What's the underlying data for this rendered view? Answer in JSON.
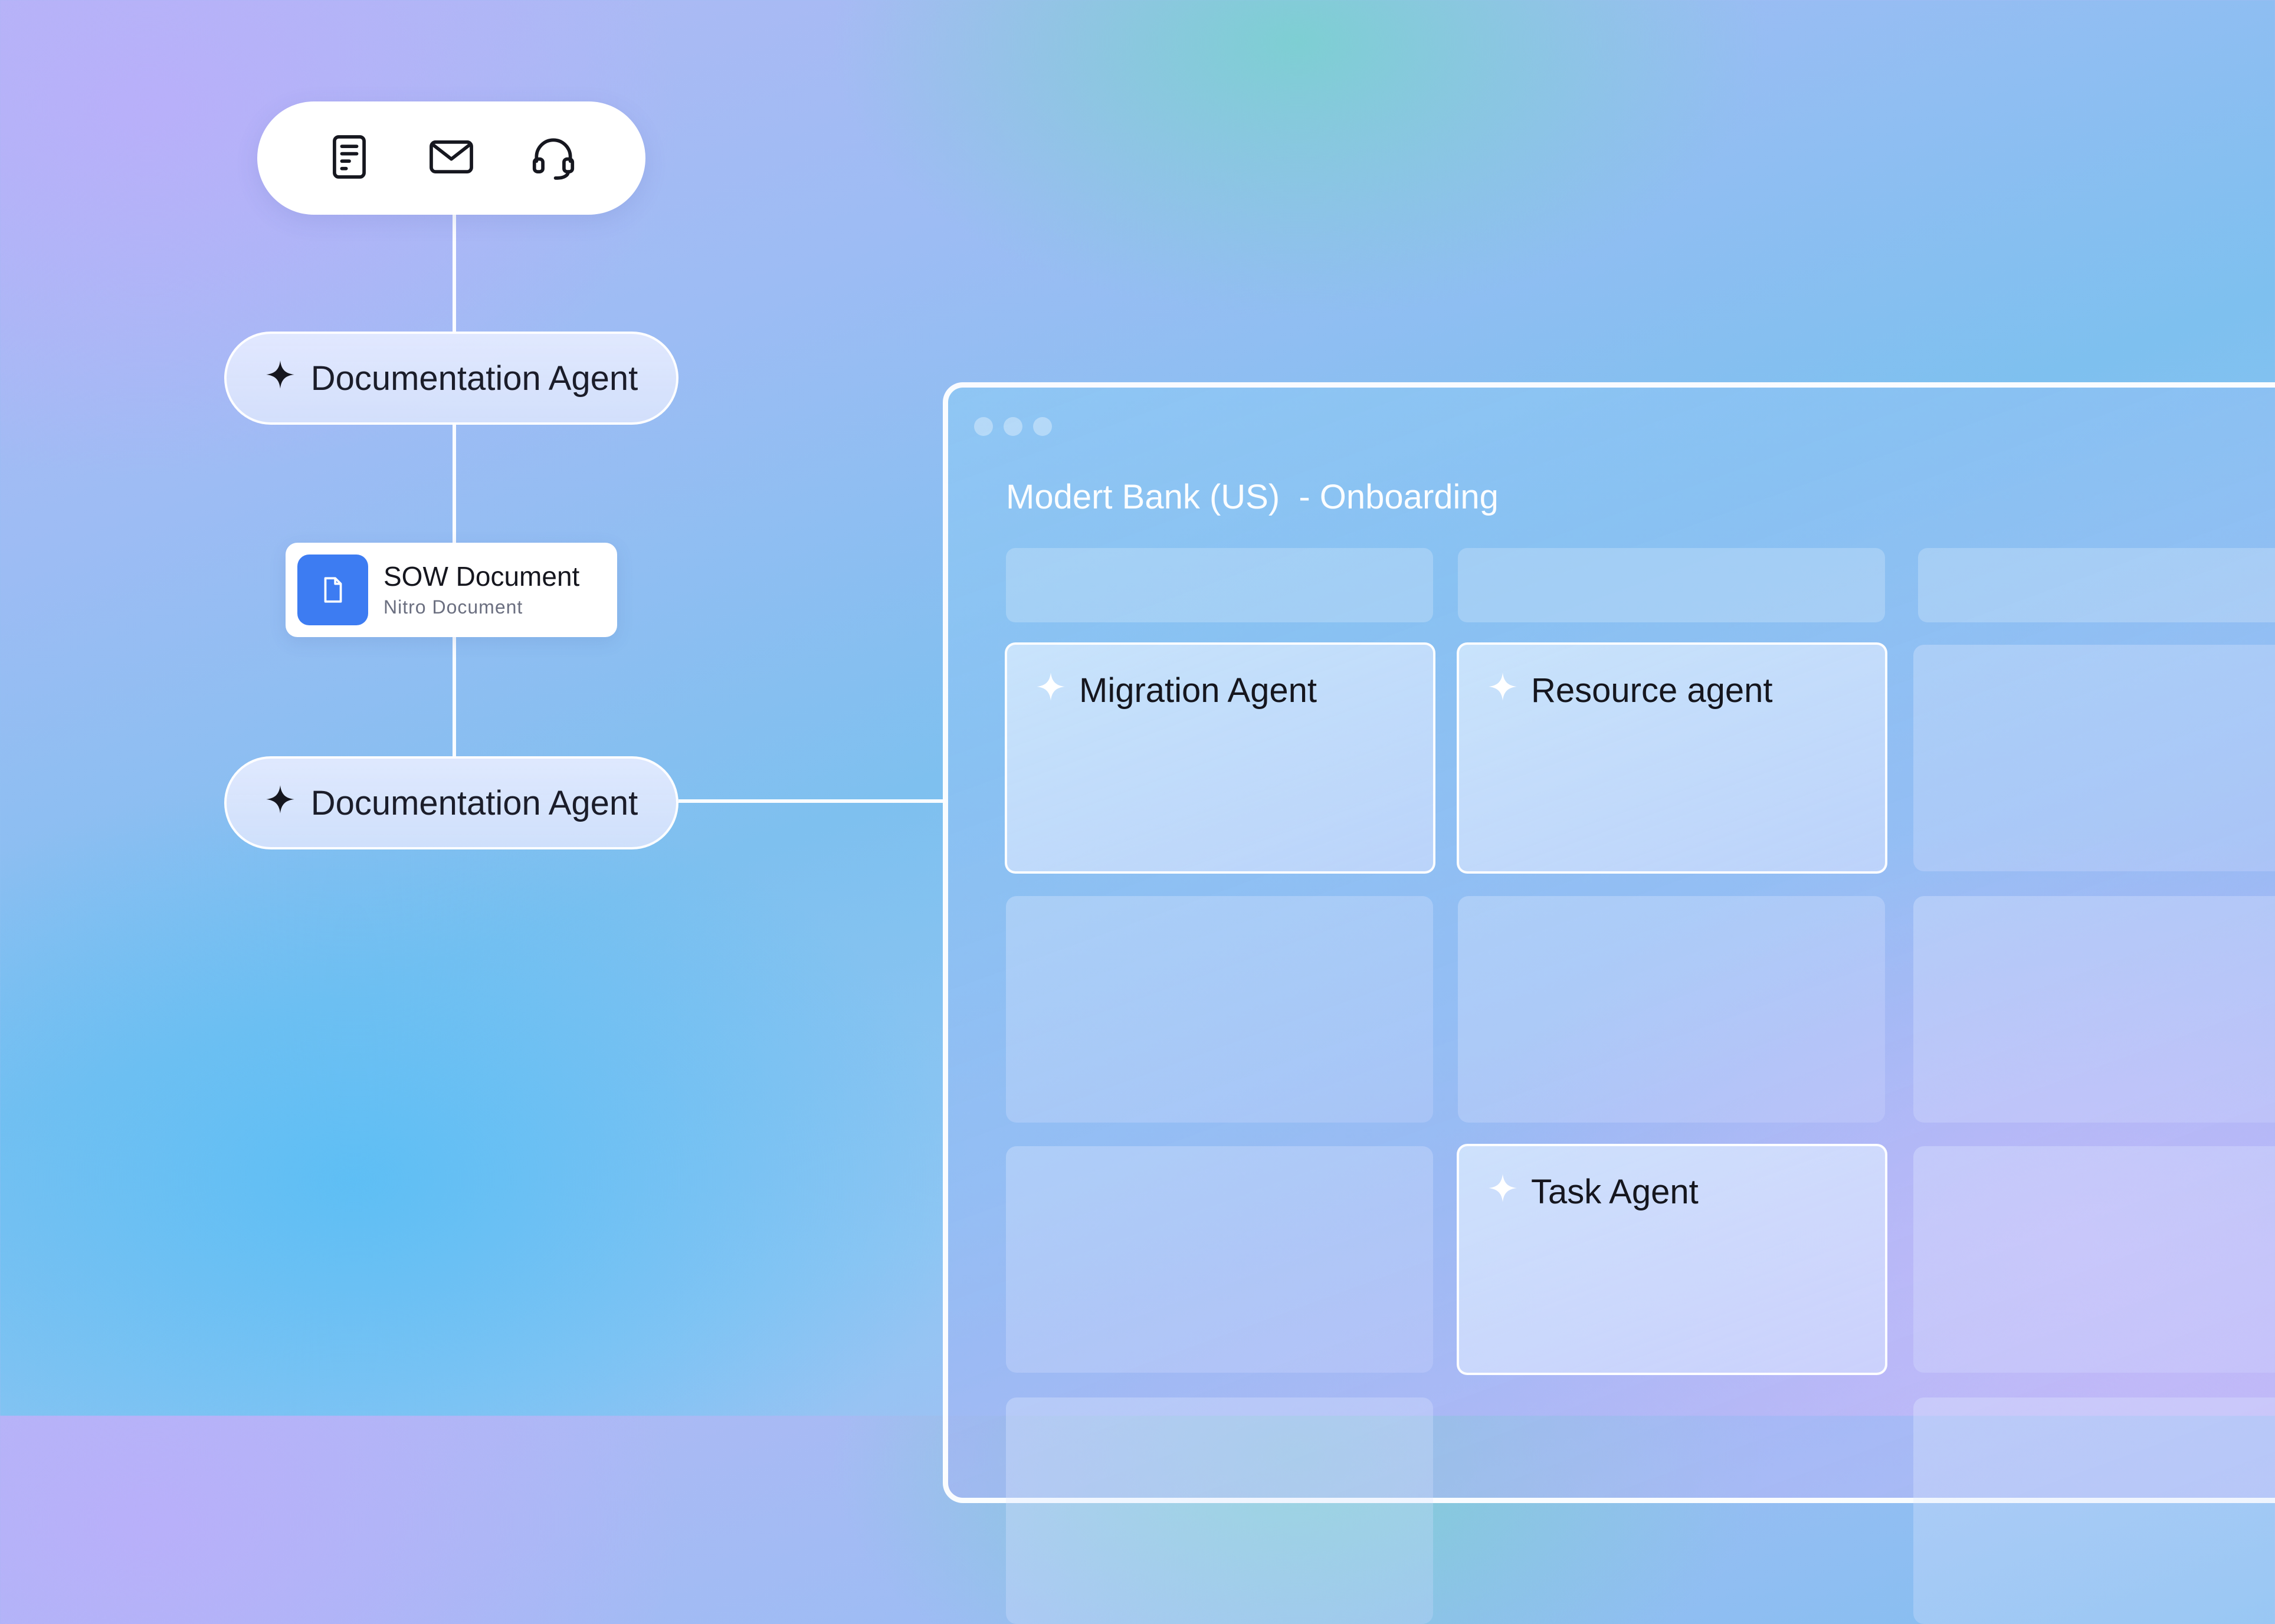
{
  "top_toolbar": {
    "icons": [
      "document-icon",
      "mail-icon",
      "headset-icon"
    ]
  },
  "flow": {
    "agent_1": {
      "label": "Documentation Agent",
      "icon": "sparkle-icon"
    },
    "document": {
      "title": "SOW Document",
      "subtitle": "Nitro Document",
      "icon": "file-icon"
    },
    "agent_2": {
      "label": "Documentation Agent",
      "icon": "sparkle-icon"
    }
  },
  "window": {
    "title": "Modert Bank (US)  - Onboarding",
    "cells": [
      {
        "label": "Migration Agent",
        "icon": "sparkle-icon"
      },
      {
        "label": "Resource agent",
        "icon": "sparkle-icon"
      },
      {
        "label": "Task Agent",
        "icon": "sparkle-icon"
      }
    ]
  },
  "colors": {
    "accent": "#3d7cf2",
    "text": "#15161e",
    "connector": "#ffffff"
  }
}
